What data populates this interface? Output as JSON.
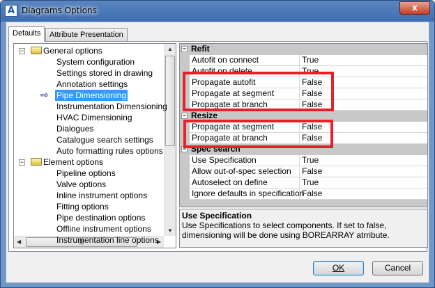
{
  "window": {
    "title": "Diagrams Options",
    "close_label": "x",
    "app_icon_letter": "A"
  },
  "tabs": [
    {
      "label": "Defaults",
      "active": true
    },
    {
      "label": "Attribute Presentation",
      "active": false
    }
  ],
  "tree": {
    "groups": [
      {
        "label": "General options",
        "expanded": true,
        "items": [
          "System configuration",
          "Settings stored in drawing",
          "Annotation settings",
          "Pipe Dimensioning",
          "Instrumentation Dimensioning",
          "HVAC Dimensioning",
          "Dialogues",
          "Catalogue search settings",
          "Auto formatting rules options"
        ]
      },
      {
        "label": "Element options",
        "expanded": true,
        "items": [
          "Pipeline options",
          "Valve options",
          "Inline instrument options",
          "Fitting options",
          "Pipe destination options",
          "Offline instrument options",
          "Instrumentation line options"
        ]
      }
    ],
    "selected": "Pipe Dimensioning"
  },
  "grid": {
    "sections": [
      {
        "title": "Refit",
        "rows": [
          {
            "name": "Autofit on connect",
            "value": "True"
          },
          {
            "name": "Autofit on delete",
            "value": "True"
          },
          {
            "name": "Propagate autofit",
            "value": "False"
          },
          {
            "name": "Propagate at segment",
            "value": "False"
          },
          {
            "name": "Propagate at branch",
            "value": "False"
          }
        ]
      },
      {
        "title": "Resize",
        "rows": [
          {
            "name": "Propagate at segment",
            "value": "False"
          },
          {
            "name": "Propagate at branch",
            "value": "False"
          }
        ]
      },
      {
        "title": "Spec search",
        "rows": [
          {
            "name": "Use Specification",
            "value": "True"
          },
          {
            "name": "Allow out-of-spec selection",
            "value": "False"
          },
          {
            "name": "Autoselect on define",
            "value": "True"
          },
          {
            "name": "Ignore defaults in specification",
            "value": "False"
          }
        ]
      }
    ],
    "highlight_color": "#e8202a"
  },
  "description": {
    "title": "Use Specification",
    "text": "Use Specifications to select components. If set to false, dimensioning will be done using BOREARRAY atrribute."
  },
  "buttons": {
    "ok": "OK",
    "cancel": "Cancel"
  }
}
